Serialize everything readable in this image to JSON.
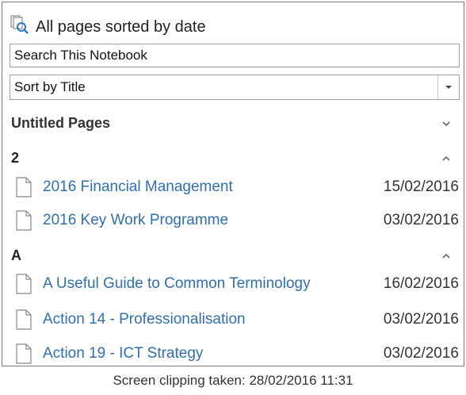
{
  "header": {
    "title": "All pages sorted by date",
    "icon": "pages-search-icon"
  },
  "search": {
    "value": "Search This Notebook"
  },
  "sort": {
    "selected": "Sort by Title"
  },
  "sections": {
    "untitled_label": "Untitled Pages"
  },
  "groups": [
    {
      "label": "2",
      "pages": [
        {
          "name": "2016 Financial Management",
          "date": "15/02/2016"
        },
        {
          "name": "2016 Key Work Programme",
          "date": "03/02/2016"
        }
      ]
    },
    {
      "label": "A",
      "pages": [
        {
          "name": "A Useful Guide to Common Terminology",
          "date": "16/02/2016"
        },
        {
          "name": "Action 14 - Professionalisation",
          "date": "03/02/2016"
        },
        {
          "name": "Action 19 - ICT Strategy",
          "date": "03/02/2016"
        }
      ]
    }
  ],
  "caption": "Screen clipping taken: 28/02/2016 11:31",
  "colors": {
    "link": "#2f6fb0",
    "border": "#7a7a7a",
    "icon_blue": "#2a74c9"
  }
}
